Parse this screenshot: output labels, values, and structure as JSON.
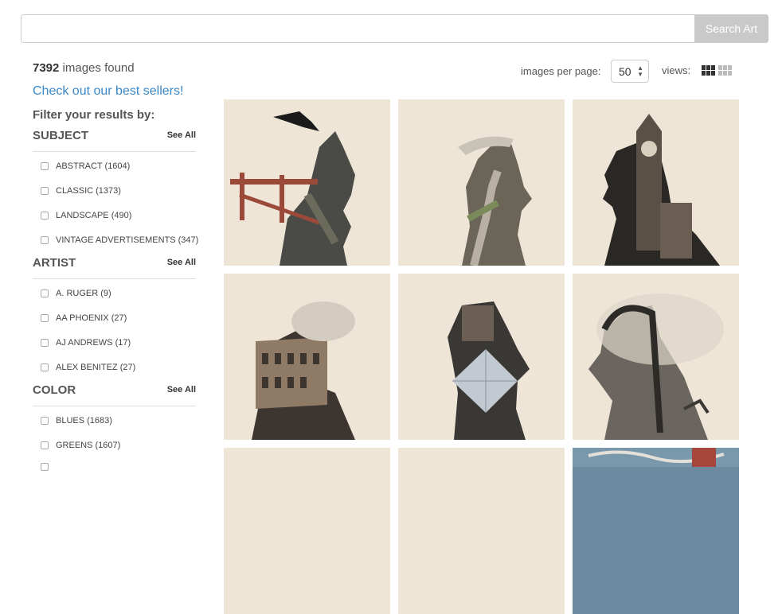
{
  "search": {
    "placeholder": "",
    "button_label": "Search Art"
  },
  "results": {
    "count": "7392",
    "suffix": " images found"
  },
  "best_sellers_link": "Check out our best sellers!",
  "filter_title": "Filter your results by:",
  "filters": [
    {
      "title": "SUBJECT",
      "see_all": "See All",
      "options": [
        "ABSTRACT (1604)",
        "CLASSIC (1373)",
        "LANDSCAPE (490)",
        "VINTAGE ADVERTISEMENTS (347)"
      ]
    },
    {
      "title": "ARTIST",
      "see_all": "See All",
      "options": [
        "A. RUGER (9)",
        "AA PHOENIX (27)",
        "AJ ANDREWS (17)",
        "ALEX BENITEZ (27)"
      ]
    },
    {
      "title": "COLOR",
      "see_all": "See All",
      "options": [
        "BLUES (1683)",
        "GREENS (1607)"
      ]
    }
  ],
  "controls": {
    "images_per_page_label": "images per page:",
    "images_per_page_value": "50",
    "views_label": "views:"
  },
  "colors": {
    "accent_link": "#3a87c8",
    "tile_bg": "#eee5d7",
    "button_bg": "#c9c9c9"
  },
  "gallery": [
    "silhouette-golden-gate-bridge",
    "silhouette-great-wall",
    "silhouette-big-ben",
    "silhouette-colosseum",
    "silhouette-louvre-pyramid",
    "silhouette-roller-coaster",
    "art-tile-partial",
    "art-tile-partial",
    "graffiti-tile-partial"
  ]
}
